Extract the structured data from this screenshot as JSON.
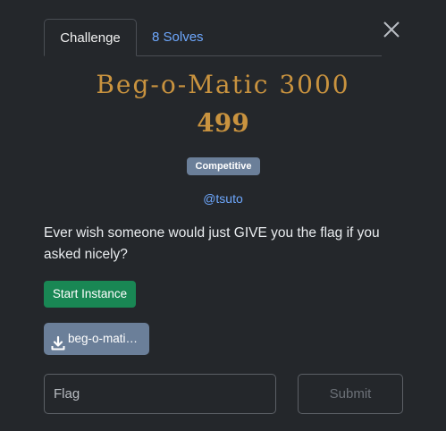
{
  "tabs": [
    {
      "label": "Challenge",
      "active": true
    },
    {
      "label": "8 Solves",
      "active": false
    }
  ],
  "challenge": {
    "name": "Beg-o-Matic 3000",
    "points": "499",
    "category_badge": "Competitive",
    "author": "@tsuto",
    "description": "Ever wish someone would just GIVE you the flag if you asked nicely?"
  },
  "actions": {
    "start_instance_label": "Start Instance",
    "file_label": "beg-o-mati…",
    "file_icon": "download-icon"
  },
  "flag_form": {
    "input_placeholder": "Flag",
    "input_value": "",
    "submit_label": "Submit"
  },
  "colors": {
    "title": "#c9933f",
    "link": "#6ea8fe",
    "badge": "#6b7f99",
    "start_button": "#198754",
    "background": "#24272b"
  },
  "close_icon": "close-icon"
}
